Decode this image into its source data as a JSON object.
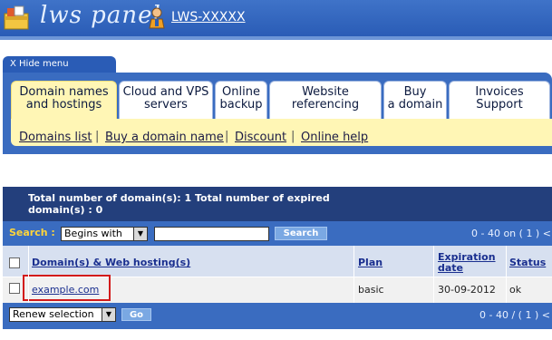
{
  "header": {
    "logo_icon": "folder-box-icon",
    "logo_text": "lws panel",
    "user_icon": "user-icon",
    "account_link": "LWS-XXXXX"
  },
  "menu": {
    "hide_label": "X Hide menu",
    "tabs": [
      {
        "line1": "Domain names",
        "line2": "and hostings",
        "active": true
      },
      {
        "line1": "Cloud and VPS",
        "line2": "servers",
        "active": false
      },
      {
        "line1": "Online",
        "line2": "backup",
        "active": false
      },
      {
        "line1": "Website",
        "line2": "referencing",
        "active": false
      },
      {
        "line1": "Buy",
        "line2": "a domain",
        "active": false
      },
      {
        "line1": "Invoices",
        "line2": "Support",
        "active": false
      }
    ],
    "subitems": [
      "Domains list",
      "Buy a domain name",
      "Discount",
      "Online help"
    ]
  },
  "domains": {
    "summary": "Total number of domain(s): 1 Total number of expired domain(s) : 0",
    "search_label": "Search :",
    "search_mode": "Begins with",
    "search_value": "",
    "search_button": "Search",
    "pager_top": "0 - 40 on ( 1 ) <",
    "columns": {
      "domain": "Domain(s) & Web hosting(s)",
      "plan": "Plan",
      "expiration": "Expiration date",
      "status": "Status"
    },
    "rows": [
      {
        "domain": "example.com",
        "plan": "basic",
        "expiration": "30-09-2012",
        "status": "ok",
        "highlighted": true
      }
    ],
    "bulk_action": "Renew selection",
    "go_button": "Go",
    "pager_bottom": "0 - 40 / ( 1 ) <"
  },
  "colors": {
    "header_blue": "#2a5cb6",
    "menu_blue": "#3a6cc0",
    "active_tab_yellow": "#fff6b5",
    "info_navy": "#233f7c",
    "highlight_red": "#d21a1a",
    "search_label_yellow": "#ffd53a"
  }
}
